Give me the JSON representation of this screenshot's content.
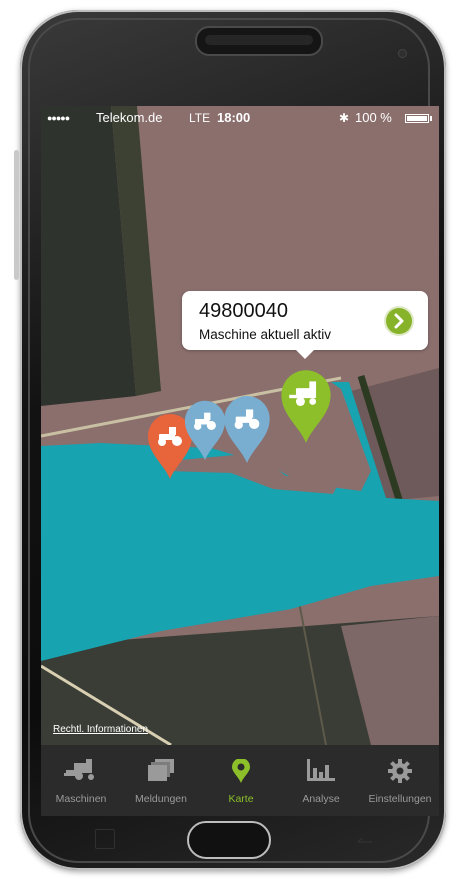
{
  "device": {
    "kind": "smartphone"
  },
  "status_bar": {
    "signal_dots": "●●●●●",
    "carrier": "Telekom.de",
    "network": "LTE",
    "time": "18:00",
    "bluetooth_icon": "bluetooth-icon",
    "battery_percent": "100 %"
  },
  "map": {
    "callout": {
      "machine_id": "49800040",
      "status": "Maschine aktuell aktiv",
      "action_icon": "chevron-right-icon"
    },
    "markers": [
      {
        "kind": "tractor",
        "color": "#e8643a",
        "icon": "tractor-icon"
      },
      {
        "kind": "tractor",
        "color": "#7aaed0",
        "icon": "tractor-icon"
      },
      {
        "kind": "tractor",
        "color": "#7aaed0",
        "icon": "tractor-icon"
      },
      {
        "kind": "combine-harvester",
        "color": "#8cbf2a",
        "icon": "combine-harvester-icon",
        "selected": true
      }
    ],
    "legal_link": "Rechtl. Informationen",
    "colors": {
      "field_worked": "#17a3b0",
      "field_brown": "#8a6f6d",
      "field_dark": "#2f332d"
    }
  },
  "tab_bar": {
    "tabs": [
      {
        "label": "Maschinen",
        "icon": "combine-harvester-icon",
        "active": false
      },
      {
        "label": "Meldungen",
        "icon": "messages-stack-icon",
        "active": false
      },
      {
        "label": "Karte",
        "icon": "map-pin-icon",
        "active": true
      },
      {
        "label": "Analyse",
        "icon": "bar-chart-icon",
        "active": false
      },
      {
        "label": "Einstellungen",
        "icon": "gear-icon",
        "active": false
      }
    ],
    "active_color": "#8cbf2a",
    "inactive_color": "#9a9a9a"
  }
}
